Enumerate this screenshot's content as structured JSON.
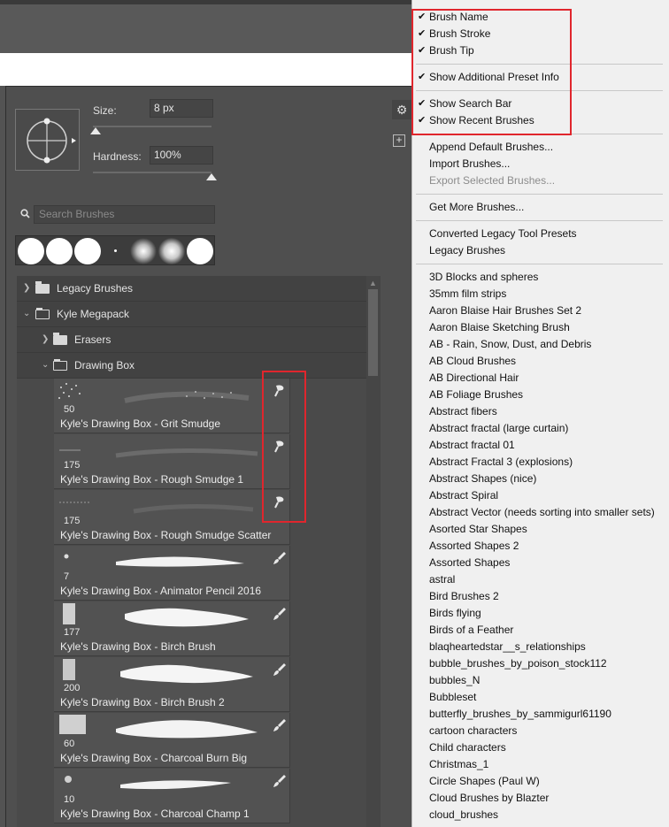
{
  "brush_settings": {
    "size_label": "Size:",
    "size_value": "8 px",
    "size_slider": 0.02,
    "hardness_label": "Hardness:",
    "hardness_value": "100%",
    "hardness_slider": 1.0
  },
  "search": {
    "placeholder": "Search Brushes"
  },
  "tree": {
    "folders": [
      {
        "label": "Legacy Brushes",
        "expanded": false
      },
      {
        "label": "Kyle Megapack",
        "expanded": true
      },
      {
        "label": "Erasers",
        "expanded": false
      },
      {
        "label": "Drawing Box",
        "expanded": true
      }
    ],
    "brushes": [
      {
        "size": "50",
        "name": "Kyle's Drawing Box - Grit Smudge",
        "tool": "smudge-icon"
      },
      {
        "size": "175",
        "name": "Kyle's Drawing Box - Rough Smudge 1",
        "tool": "smudge-icon"
      },
      {
        "size": "175",
        "name": "Kyle's Drawing Box - Rough Smudge Scatter",
        "tool": "smudge-icon"
      },
      {
        "size": "7",
        "name": "Kyle's Drawing Box - Animator Pencil 2016",
        "tool": "brush-icon"
      },
      {
        "size": "177",
        "name": "Kyle's Drawing Box - Birch Brush",
        "tool": "brush-icon"
      },
      {
        "size": "200",
        "name": "Kyle's Drawing Box - Birch Brush 2",
        "tool": "brush-icon"
      },
      {
        "size": "60",
        "name": "Kyle's Drawing Box - Charcoal Burn Big",
        "tool": "brush-icon"
      },
      {
        "size": "10",
        "name": "Kyle's Drawing Box - Charcoal Champ 1",
        "tool": "brush-icon"
      }
    ]
  },
  "menu": {
    "checked_group_1": [
      "Brush Name",
      "Brush Stroke",
      "Brush Tip"
    ],
    "checked_group_2": [
      "Show Additional Preset Info"
    ],
    "checked_group_3": [
      "Show Search Bar",
      "Show Recent Brushes"
    ],
    "actions": [
      "Append Default Brushes...",
      "Import Brushes...",
      "Export Selected Brushes..."
    ],
    "more": [
      "Get More Brushes..."
    ],
    "converted": [
      "Converted Legacy Tool Presets",
      "Legacy Brushes"
    ],
    "brush_sets": [
      "3D Blocks and spheres",
      "35mm film strips",
      "Aaron Blaise Hair Brushes Set 2",
      "Aaron Blaise Sketching Brush",
      "AB - Rain, Snow, Dust, and Debris",
      "AB Cloud Brushes",
      "AB Directional Hair",
      "AB Foliage Brushes",
      "Abstract fibers",
      "Abstract fractal (large curtain)",
      "Abstract fractal 01",
      "Abstract Fractal 3 (explosions)",
      "Abstract Shapes (nice)",
      "Abstract Spiral",
      "Abstract Vector (needs sorting into smaller sets)",
      "Asorted Star Shapes",
      "Assorted Shapes 2",
      "Assorted Shapes",
      "astral",
      "Bird Brushes 2",
      "Birds flying",
      "Birds of a Feather",
      "blaqheartedstar__s_relationships",
      "bubble_brushes_by_poison_stock112",
      "bubbles_N",
      "Bubbleset",
      "butterfly_brushes_by_sammigurl61190",
      "cartoon characters",
      "Child characters",
      "Christmas_1",
      "Circle Shapes (Paul W)",
      "Cloud Brushes by Blazter",
      "cloud_brushes"
    ]
  },
  "colors": {
    "highlight": "#e0262d",
    "panel": "#4f4f4f",
    "menu_bg": "#f0f0f0"
  }
}
